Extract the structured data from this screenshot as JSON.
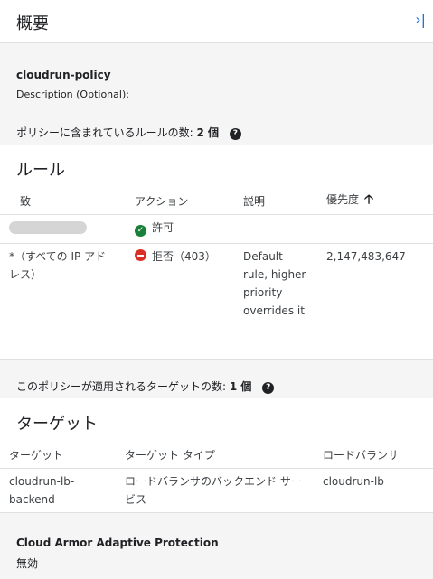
{
  "header": {
    "title": "概要",
    "collapse_icon": "last-page-icon"
  },
  "policy": {
    "name": "cloudrun-policy",
    "description_label": "Description (Optional):",
    "rules_count_label": "ポリシーに含まれているルールの数:",
    "rules_count": "2 個"
  },
  "rules": {
    "title": "ルール",
    "columns": [
      "一致",
      "アクション",
      "説明",
      "優先度"
    ],
    "sort_column": "優先度",
    "rows": [
      {
        "match": "",
        "match_redacted": true,
        "action_icon": "check-circle-icon",
        "action": "許可",
        "description": "",
        "priority": ""
      },
      {
        "match": "*（すべての IP アドレス）",
        "action_icon": "deny-icon",
        "action": "拒否（403）",
        "description": "Default rule, higher priority overrides it",
        "priority": "2,147,483,647"
      }
    ]
  },
  "targets": {
    "count_label": "このポリシーが適用されるターゲットの数:",
    "count": "1 個",
    "title": "ターゲット",
    "columns": [
      "ターゲット",
      "ターゲット タイプ",
      "ロードバランサ"
    ],
    "rows": [
      {
        "target": "cloudrun-lb-backend",
        "type": "ロードバランサのバックエンド サービス",
        "lb": "cloudrun-lb"
      }
    ]
  },
  "adaptive": {
    "title": "Cloud Armor Adaptive Protection",
    "value": "無効"
  },
  "colors": {
    "accent": "#1a73e8",
    "allow": "#188038",
    "deny": "#d93025"
  }
}
